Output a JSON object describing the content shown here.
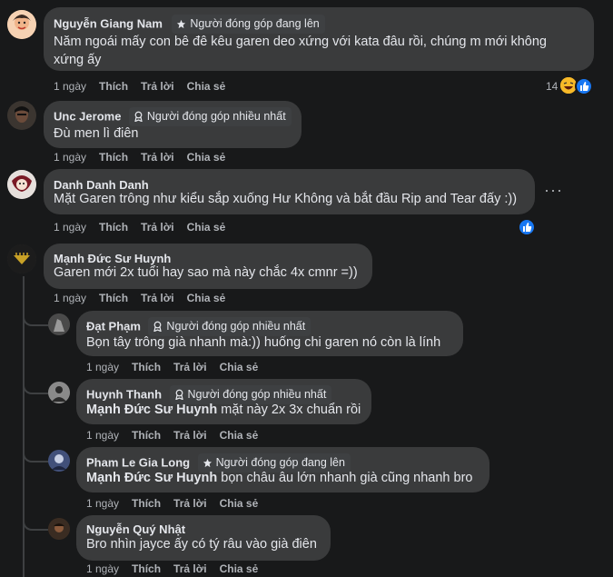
{
  "colors": {
    "background": "#18191a",
    "bubble": "#3a3b3c",
    "text": "#e4e6eb",
    "muted": "#b0b3b8",
    "like_blue": "#1877f2"
  },
  "comments": [
    {
      "author": "Nguyễn Giang Nam",
      "badge": "Người đóng góp đang lên",
      "badge_icon": "star-icon",
      "text_line1": "Năm ngoái mấy con bê đê kêu garen deo xứng với kata đâu rồi, chúng m mới không",
      "text_line2": "xứng ấy",
      "time": "1 ngày",
      "like": "Thích",
      "reply": "Trả lời",
      "share": "Chia sẻ",
      "reaction_count": "14",
      "reactions": [
        "haha-icon",
        "like-icon"
      ]
    },
    {
      "author": "Unc Jerome",
      "badge": "Người đóng góp nhiều nhất",
      "badge_icon": "medal-icon",
      "text": "Đù men lì điên",
      "time": "1 ngày",
      "like": "Thích",
      "reply": "Trả lời",
      "share": "Chia sẻ"
    },
    {
      "author": "Danh Danh Danh",
      "text": "Mặt Garen trông như kiểu sắp xuống Hư Không và bắt đầu Rip and Tear đấy :))",
      "time": "1 ngày",
      "like": "Thích",
      "reply": "Trả lời",
      "share": "Chia sẻ",
      "reactions": [
        "like-icon"
      ],
      "more": "···"
    },
    {
      "author": "Mạnh Đức Sư Huynh",
      "text": "Garen mới 2x tuổi hay sao mà này chắc 4x cmnr =))",
      "time": "1 ngày",
      "like": "Thích",
      "reply": "Trả lời",
      "share": "Chia sẻ",
      "replies": [
        {
          "author": "Đạt Phạm",
          "badge": "Người đóng góp nhiều nhất",
          "badge_icon": "medal-icon",
          "text": "Bọn tây trông già nhanh mà:)) huống chi garen nó còn là lính",
          "time": "1 ngày",
          "like": "Thích",
          "reply": "Trả lời",
          "share": "Chia sẻ"
        },
        {
          "author": "Huynh Thanh",
          "badge": "Người đóng góp nhiều nhất",
          "badge_icon": "medal-icon",
          "mention": "Mạnh Đức Sư Huynh",
          "text": " mặt này 2x 3x chuẩn rồi",
          "time": "1 ngày",
          "like": "Thích",
          "reply": "Trả lời",
          "share": "Chia sẻ"
        },
        {
          "author": "Pham Le Gia Long",
          "badge": "Người đóng góp đang lên",
          "badge_icon": "star-icon",
          "mention": "Mạnh Đức Sư Huynh",
          "text": " bọn châu âu lớn nhanh già cũng nhanh bro",
          "time": "1 ngày",
          "like": "Thích",
          "reply": "Trả lời",
          "share": "Chia sẻ"
        },
        {
          "author": "Nguyễn Quý Nhật",
          "text": "Bro nhìn jayce ấy có tý râu vào già điên",
          "time": "1 ngày",
          "like": "Thích",
          "reply": "Trả lời",
          "share": "Chia sẻ"
        }
      ]
    }
  ]
}
